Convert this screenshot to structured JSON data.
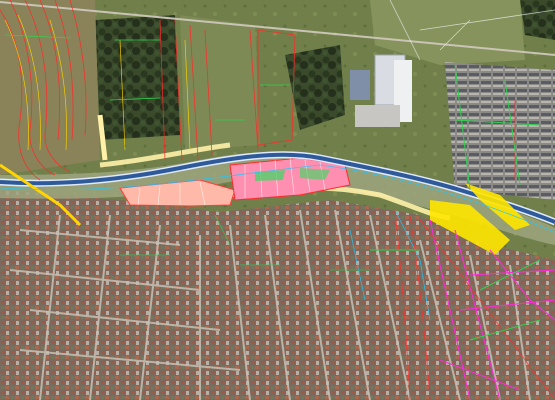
{
  "map": {
    "kind": "aerial-imagery-with-cad-overlay",
    "colors": {
      "farmland": "#6b7a47",
      "forest": "#2f3d24",
      "urban_roofs": "#8a5a48",
      "urban_gray": "#77736c",
      "roads": "#b9b6ad",
      "river": "#2f5a9a",
      "river_edge": "#dfe9ff",
      "cad_red": "#ff2a2a",
      "cad_yellow": "#ffd400",
      "cad_green": "#2fd14f",
      "cad_cyan": "#22c7ff",
      "cad_magenta": "#ff2adf",
      "parcel_pink": "#ff6b8a",
      "parcel_salmon": "#ffb4a8",
      "highlight_yellow": "#ffe600",
      "white_lines": "#f4f4f4"
    },
    "features": [
      "river-corridor",
      "planned-parcels",
      "urban-residential-grid",
      "gated-condominium",
      "industrial-buildings",
      "cad-contour-lines"
    ]
  }
}
